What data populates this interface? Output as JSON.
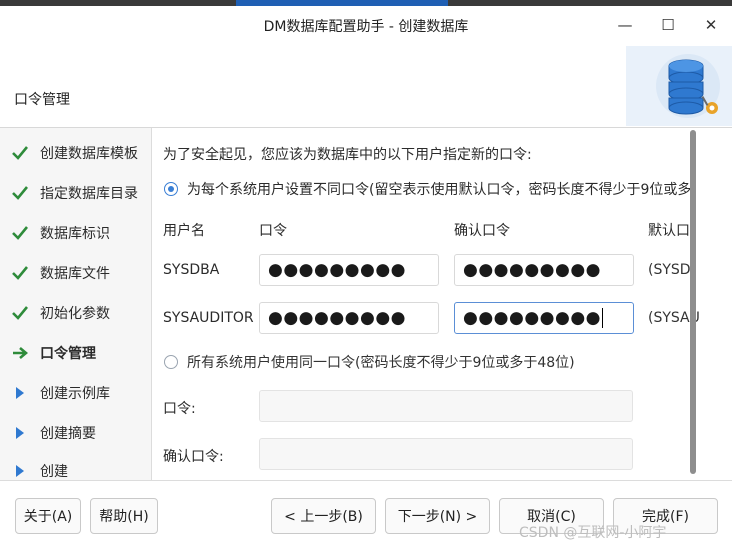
{
  "window": {
    "title": "DM数据库配置助手 - 创建数据库",
    "minimize_glyph": "—",
    "maximize_glyph": "☐",
    "close_glyph": "✕"
  },
  "header": {
    "heading": "口令管理",
    "logo_icon": "database-gear-icon"
  },
  "sidebar": {
    "steps": [
      {
        "label": "创建数据库模板",
        "state": "done",
        "icon": "check-icon"
      },
      {
        "label": "指定数据库目录",
        "state": "done",
        "icon": "check-icon"
      },
      {
        "label": "数据库标识",
        "state": "done",
        "icon": "check-icon"
      },
      {
        "label": "数据库文件",
        "state": "done",
        "icon": "check-icon"
      },
      {
        "label": "初始化参数",
        "state": "done",
        "icon": "check-icon"
      },
      {
        "label": "口令管理",
        "state": "current",
        "icon": "arrow-right-icon"
      },
      {
        "label": "创建示例库",
        "state": "pending",
        "icon": "triangle-right-icon"
      },
      {
        "label": "创建摘要",
        "state": "pending",
        "icon": "triangle-right-icon"
      },
      {
        "label": "创建",
        "state": "pending",
        "icon": "triangle-right-icon"
      }
    ]
  },
  "content": {
    "intro": "为了安全起见，您应该为数据库中的以下用户指定新的口令:",
    "option_separate": "为每个系统用户设置不同口令(留空表示使用默认口令，密码长度不得少于9位或多",
    "option_separate_selected": true,
    "columns": {
      "user": "用户名",
      "password": "口令",
      "confirm": "确认口令",
      "default": "默认口"
    },
    "users": [
      {
        "name": "SYSDBA",
        "password": "●●●●●●●●●",
        "confirm": "●●●●●●●●●",
        "default": "(SYSDI"
      },
      {
        "name": "SYSAUDITOR",
        "password": "●●●●●●●●●",
        "confirm": "●●●●●●●●●",
        "default": "(SYSAU"
      }
    ],
    "option_same": "所有系统用户使用同一口令(密码长度不得少于9位或多于48位)",
    "option_same_selected": false,
    "same_password_label": "口令:",
    "same_password_value": "",
    "same_confirm_label": "确认口令:",
    "same_confirm_value": ""
  },
  "footer": {
    "about": "关于(A)",
    "help": "帮助(H)",
    "back": "< 上一步(B)",
    "next": "下一步(N) >",
    "cancel": "取消(C)",
    "finish": "完成(F)"
  },
  "watermark": "CSDN @互联网-小阿宇",
  "colors": {
    "check": "#2e8b3a",
    "accent": "#1f5fb4",
    "radio": "#3a7fd5"
  }
}
